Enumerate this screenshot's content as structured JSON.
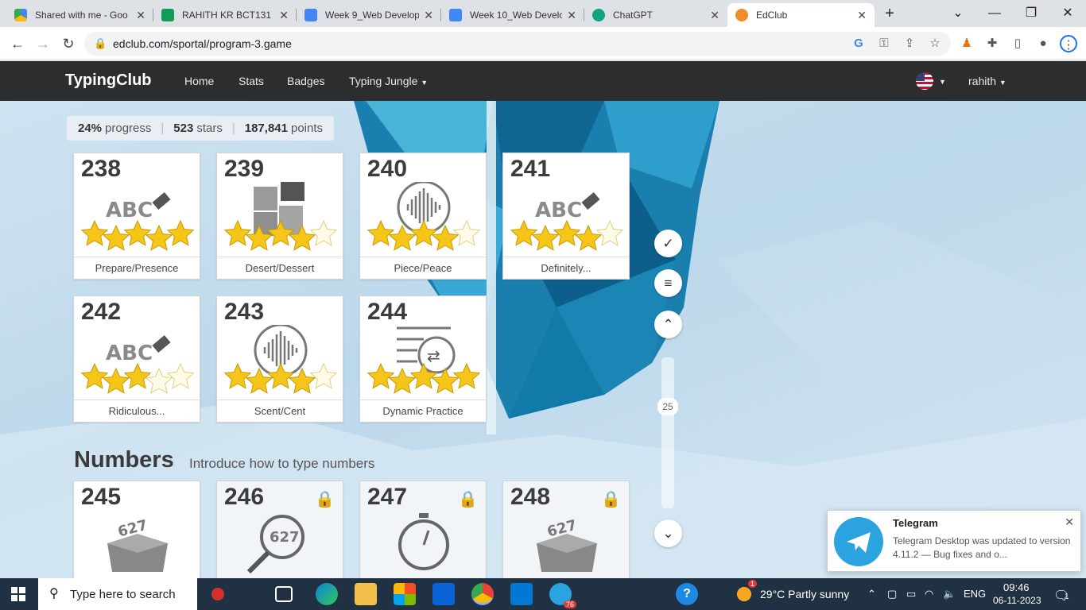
{
  "browser": {
    "tabs": [
      {
        "title": "Shared with me - Goo",
        "color": "#34a853"
      },
      {
        "title": "RAHITH KR BCT131 : I",
        "color": "#0f9d58"
      },
      {
        "title": "Week 9_Web Develop",
        "color": "#4285f4"
      },
      {
        "title": "Week 10_Web Develo",
        "color": "#4285f4"
      },
      {
        "title": "ChatGPT",
        "color": "#10a37f"
      },
      {
        "title": "EdClub",
        "color": "#f28c28"
      }
    ],
    "url": "edclub.com/sportal/program-3.game"
  },
  "site": {
    "brand": "TypingClub",
    "nav": [
      "Home",
      "Stats",
      "Badges",
      "Typing Jungle"
    ],
    "user": "rahith"
  },
  "progress": {
    "percent": "24%",
    "percent_label": "progress",
    "stars": "523",
    "stars_label": "stars",
    "points": "187,841",
    "points_label": "points"
  },
  "lessons": [
    {
      "num": "238",
      "label": "Prepare/Presence",
      "icon": "abc-eraser-icon",
      "stars": 5
    },
    {
      "num": "239",
      "label": "Desert/Dessert",
      "icon": "puzzle-icon",
      "stars": 4
    },
    {
      "num": "240",
      "label": "Piece/Peace",
      "icon": "sound-wave-icon",
      "stars": 4
    },
    {
      "num": "241",
      "label": "Definitely...",
      "icon": "abc-eraser-icon",
      "stars": 4
    },
    {
      "num": "242",
      "label": "Ridiculous...",
      "icon": "abc-eraser-icon",
      "stars": 3
    },
    {
      "num": "243",
      "label": "Scent/Cent",
      "icon": "sound-wave-icon",
      "stars": 4
    },
    {
      "num": "244",
      "label": "Dynamic Practice",
      "icon": "shuffle-list-icon",
      "stars": 5
    }
  ],
  "section": {
    "title": "Numbers",
    "subtitle": "Introduce how to type numbers"
  },
  "number_lessons": [
    {
      "num": "245",
      "icon": "number-box-icon",
      "locked": false
    },
    {
      "num": "246",
      "icon": "number-magnifier-icon",
      "locked": true
    },
    {
      "num": "247",
      "icon": "stopwatch-icon",
      "locked": true
    },
    {
      "num": "248",
      "icon": "number-box-icon",
      "locked": true
    }
  ],
  "slider": {
    "value": "25"
  },
  "toast": {
    "app": "Telegram",
    "message": "Telegram Desktop was updated to version 4.11.2 — Bug fixes and o..."
  },
  "taskbar": {
    "search_placeholder": "Type here to search",
    "weather": "29°C  Partly sunny",
    "lang": "ENG",
    "time": "09:46",
    "date": "06-11-2023",
    "chrome_badge": "76",
    "weather_badge": "1",
    "notif_count": "1"
  }
}
